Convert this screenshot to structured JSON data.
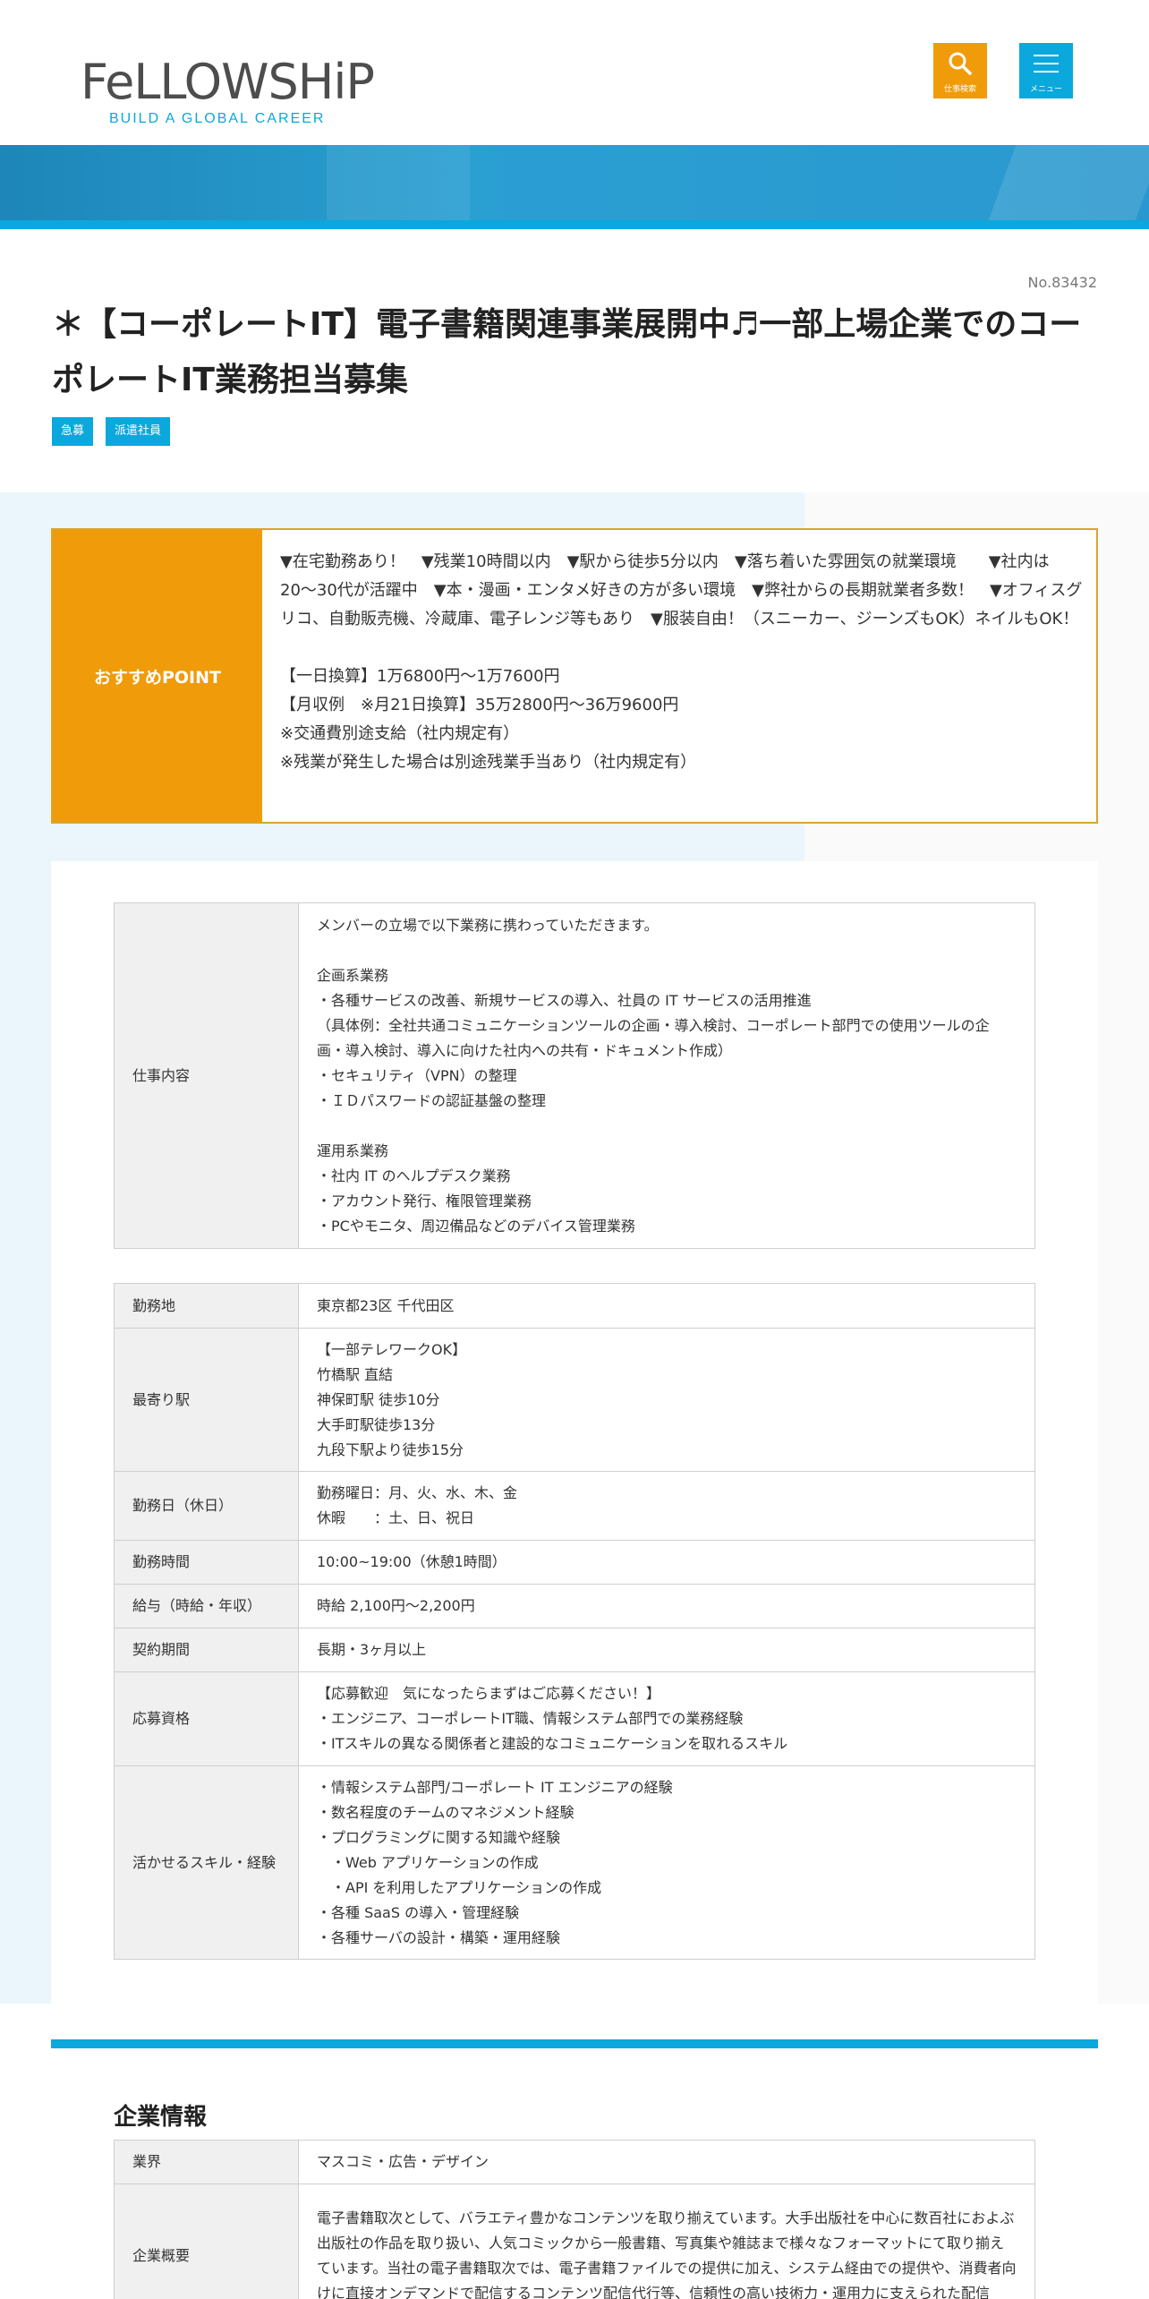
{
  "header": {
    "logo_text": "FeLLOWSHiP",
    "logo_sub": "BUILD A GLOBAL CAREER",
    "search_label": "仕事検索",
    "menu_label": "メニュー"
  },
  "job": {
    "number": "No.83432",
    "title": "＊【コーポレートIT】電子書籍関連事業展開中♬一部上場企業でのコーポレートIT業務担当募集",
    "tags": [
      "急募",
      "派遣社員"
    ]
  },
  "point": {
    "label": "おすすめPOINT",
    "text": "▼在宅勤務あり！　▼残業10時間以内　▼駅から徒歩5分以内　▼落ち着いた雰囲気の就業環境　　▼社内は20〜30代が活躍中　▼本・漫画・エンタメ好きの方が多い環境　▼弊社からの長期就業者多数！　▼オフィスグリコ、自動販売機、冷蔵庫、電子レンジ等もあり　▼服装自由！（スニーカー、ジーンズもOK）ネイルもOK！\n\n【一日換算】1万6800円〜1万7600円\n【月収例　※月21日換算】35万2800円〜36万9600円\n※交通費別途支給（社内規定有）\n※残業が発生した場合は別途残業手当あり（社内規定有）"
  },
  "details": {
    "job_content": {
      "label": "仕事内容",
      "value": "メンバーの立場で以下業務に携わっていただきます。\n\n企画系業務\n・各種サービスの改善、新規サービスの導入、社員の IT サービスの活用推進\n（具体例：全社共通コミュニケーションツールの企画・導入検討、コーポレート部門での使用ツールの企画・導入検討、導入に向けた社内への共有・ドキュメント作成）\n・セキュリティ（VPN）の整理\n・ＩＤパスワードの認証基盤の整理\n\n運用系業務\n・社内 IT のヘルプデスク業務\n・アカウント発行、権限管理業務\n・PCやモニタ、周辺備品などのデバイス管理業務"
    },
    "rows": [
      {
        "label": "勤務地",
        "value": "東京都23区 千代田区"
      },
      {
        "label": "最寄り駅",
        "value": "【一部テレワークOK】\n竹橋駅 直結\n神保町駅 徒歩10分\n大手町駅徒歩13分\n九段下駅より徒歩15分"
      },
      {
        "label": "勤務日（休日）",
        "value": "勤務曜日：月、火、水、木、金\n休暇　　：土、日、祝日"
      },
      {
        "label": "勤務時間",
        "value": "10:00~19:00（休憩1時間）"
      },
      {
        "label": "給与（時給・年収）",
        "value": "時給 2,100円〜2,200円"
      },
      {
        "label": "契約期間",
        "value": "長期・3ヶ月以上"
      },
      {
        "label": "応募資格",
        "value": "【応募歓迎　気になったらまずはご応募ください！】\n・エンジニア、コーポレートIT職、情報システム部門での業務経験\n・ITスキルの異なる関係者と建設的なコミュニケーションを取れるスキル"
      },
      {
        "label": "活かせるスキル・経験",
        "value": "・情報システム部門/コーポレート IT エンジニアの経験\n・数名程度のチームのマネジメント経験\n・プログラミングに関する知識や経験\n　・Web アプリケーションの作成\n　・API を利用したアプリケーションの作成\n・各種 SaaS の導入・管理経験\n・各種サーバの設計・構築・運用経験"
      }
    ]
  },
  "company": {
    "title": "企業情報",
    "rows": [
      {
        "label": "業界",
        "value": "マスコミ・広告・デザイン"
      },
      {
        "label": "企業概要",
        "value": "電子書籍取次として、バラエティ豊かなコンテンツを取り揃えています。大手出版社を中心に数百社におよぶ出版社の作品を取り扱い、人気コミックから一般書籍、写真集や雑誌まで様々なフォーマットにて取り揃えています。当社の電子書籍取次では、電子書籍ファイルでの提供に加え、システム経由での提供や、消費者向けに直接オンデマンドで配信するコンテンツ配信代行等、信頼性の高い技術力・運用力に支えられた配信"
      }
    ]
  }
}
